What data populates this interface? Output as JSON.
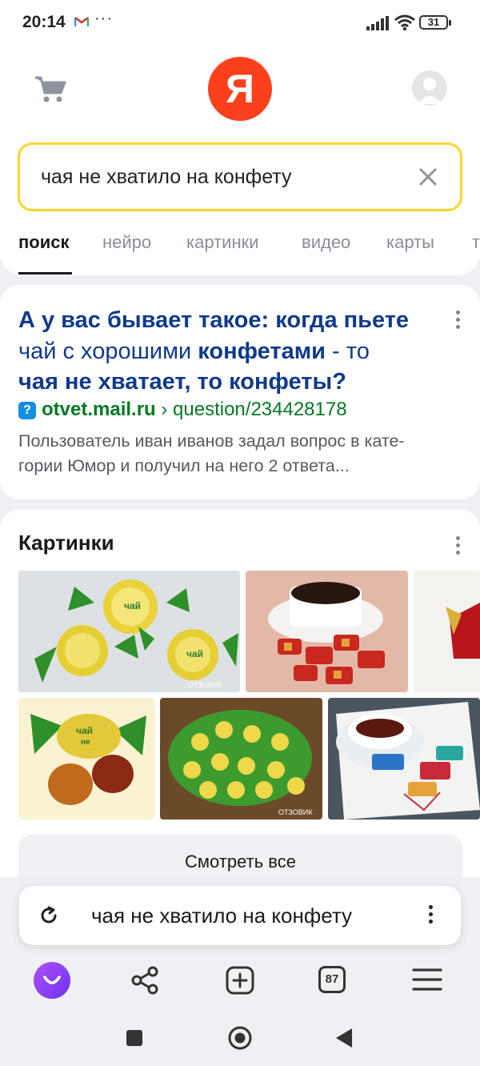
{
  "status_bar": {
    "time": "20:14",
    "more": "···",
    "battery": "31",
    "icons": [
      "gmail-icon",
      "signal-icon",
      "wifi-icon",
      "battery-icon"
    ]
  },
  "header": {
    "logo_text": "Я",
    "search_query": "чая не хватило на конфету",
    "icons": [
      "cart-icon",
      "avatar-icon",
      "clear-icon"
    ]
  },
  "tabs": [
    {
      "label": "поиск",
      "active": true
    },
    {
      "label": "нейро",
      "active": false
    },
    {
      "label": "картинки",
      "active": false
    },
    {
      "label": "видео",
      "active": false
    },
    {
      "label": "карты",
      "active": false
    },
    {
      "label": "т",
      "active": false
    }
  ],
  "result": {
    "title_line1": "А у вас бывает такое: когда пьете",
    "title_line2_a": "чай с хорошими ",
    "title_line2_b": "конфетами",
    "title_line2_c": " - то",
    "title_line3": "чая не хватает, то конфеты?",
    "favicon": "?",
    "domain": "otvet.mail.ru",
    "path": " › question/234428178",
    "snippet_line1": "Пользователь иван иванов задал вопрос в кате-",
    "snippet_line2": "гории Юмор и получил на него 2 ответа..."
  },
  "images_section": {
    "title": "Картинки",
    "watermark": "ОТЗОВИК",
    "see_all": "Смотреть все",
    "candy_text": [
      "чай",
      "не",
      "чай"
    ]
  },
  "omnibox": {
    "query": "чая не хватило на конфету"
  },
  "toolbar": {
    "tabs_count": "87",
    "icons": [
      "alice-icon",
      "share-icon",
      "new-tab-icon",
      "tabs-icon",
      "menu-icon"
    ]
  },
  "nav_bar": {
    "icons": [
      "recents-icon",
      "home-icon",
      "back-icon"
    ]
  },
  "colors": {
    "accent_yellow": "#fed42b",
    "logo_red": "#fc3f1d",
    "link_blue": "#0f3a8c",
    "url_green": "#007a22",
    "alice_purple": "#8b3ff5"
  }
}
